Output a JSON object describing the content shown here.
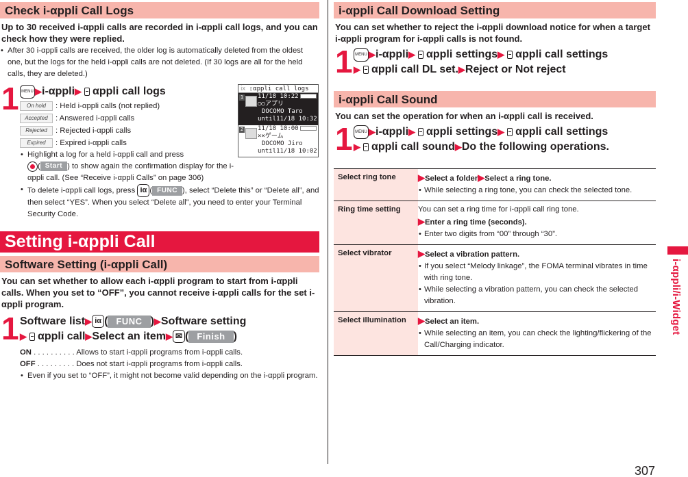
{
  "page_number": "307",
  "side_tab": {
    "label": "i-αppli/i-Widget",
    "color": "#e5173f"
  },
  "colors": {
    "accent": "#e5173f",
    "subheading_bg": "#f7b5ac",
    "table_header_bg": "#fde4e0"
  },
  "left": {
    "check_logs": {
      "heading": "Check i-αppli Call Logs",
      "intro": "Up to 30 received i-αppli calls are recorded in i-αppli call logs, and you can check how they were replied.",
      "note": "After 30 i-αppli calls are received, the older log is automatically deleted from the oldest one, but the logs for the held i-αppli calls are not deleted. (If 30 logs are all for the held calls, they are deleted.)",
      "step": {
        "number": "1",
        "menu_key": "MENU",
        "path": [
          "i-αppli",
          "αppli call logs"
        ],
        "legend": [
          {
            "chip": "On hold",
            "text": ": Held i-αppli calls (not replied)"
          },
          {
            "chip": "Accepted",
            "text": ": Answered i-αppli calls"
          },
          {
            "chip": "Rejected",
            "text": ": Rejected i-αppli calls"
          },
          {
            "chip": "Expired",
            "text": ": Expired i-αppli calls"
          }
        ],
        "bullet1_a": "Highlight a log for a held i-αppli call and press",
        "bullet1_softkey": "Start",
        "bullet1_b": ") to show again the confirmation display for the i-αppli call. (See “Receive i-αppli Calls” on page 306)",
        "bullet2_a": "To delete i-αppli call logs, press",
        "bullet2_softkey": "FUNC",
        "bullet2_b": "), select “Delete this” or “Delete all”, and then select “YES”. When you select “Delete all”, you need to enter your Terminal Security Code."
      },
      "screen": {
        "title": "αppli call logs",
        "logs": [
          {
            "index": "1",
            "datetime": "11/18 10:22",
            "status": "On hold",
            "name": "○○アプリ",
            "caller": "DOCOMO Taro",
            "until": "until11/18 10:32",
            "selected": true
          },
          {
            "index": "2",
            "datetime": "11/18 10:00",
            "status": "Accepted",
            "name": "××ゲーム",
            "caller": "DOCOMO Jiro",
            "until": "until11/18 10:02",
            "selected": false
          }
        ]
      }
    },
    "setting": {
      "heading": "Setting i-αppli Call",
      "subheading": "Software Setting (i-αppli Call)",
      "intro": "You can set whether to allow each i-αppli program to start from i-αppli calls. When you set to “OFF”, you cannot receive i-αppli calls for the set i-αppli program.",
      "step": {
        "number": "1",
        "line1_a": "Software list",
        "func_softkey": "FUNC",
        "line1_b": "Software setting",
        "line2_a": "αppli call",
        "line2_b": "Select an item",
        "finish_softkey": "Finish"
      },
      "options": [
        {
          "key": "ON",
          "dots": " . . . . . . . . . . ",
          "text": "Allows to start i-αppli programs from i-αppli calls."
        },
        {
          "key": "OFF",
          "dots": " . . . . . . . . . ",
          "text": "Does not start i-αppli programs from i-αppli calls."
        }
      ],
      "note": "Even if you set to “OFF”, it might not become valid depending on the i-αppli program."
    }
  },
  "right": {
    "download": {
      "heading": "i-αppli Call Download Setting",
      "intro": "You can set whether to reject the i-αppli download notice for when a target i-αppli program for i-αppli calls is not found.",
      "step": {
        "number": "1",
        "menu_key": "MENU",
        "line1": [
          "i-αppli",
          "αppli settings",
          "αppli call settings"
        ],
        "line2": [
          "αppli call DL set.",
          "Reject or Not reject"
        ]
      }
    },
    "sound": {
      "heading": "i-αppli Call Sound",
      "intro": "You can set the operation for when an i-αppli call is received.",
      "step": {
        "number": "1",
        "menu_key": "MENU",
        "line1": [
          "i-αppli",
          "αppli settings",
          "αppli call settings"
        ],
        "line2": [
          "αppli call sound",
          "Do the following operations."
        ]
      },
      "table": [
        {
          "label": "Select ring tone",
          "intro": "",
          "actions": [
            "Select a folder",
            "Select a ring tone."
          ],
          "bullets": [
            "While selecting a ring tone, you can check the selected tone."
          ]
        },
        {
          "label": "Ring time setting",
          "intro": "You can set a ring time for i-αppli call ring tone.",
          "actions": [
            "Enter a ring time (seconds)."
          ],
          "bullets": [
            "Enter two digits from “00” through “30”."
          ]
        },
        {
          "label": "Select vibrator",
          "intro": "",
          "actions": [
            "Select a vibration pattern."
          ],
          "bullets": [
            "If you select “Melody linkage”, the FOMA terminal vibrates in time with ring tone.",
            "While selecting a vibration pattern, you can check the selected vibration."
          ]
        },
        {
          "label": "Select illumination",
          "intro": "",
          "actions": [
            "Select an item."
          ],
          "bullets": [
            "While selecting an item, you can check the lighting/flickering of the Call/Charging indicator."
          ]
        }
      ]
    }
  }
}
